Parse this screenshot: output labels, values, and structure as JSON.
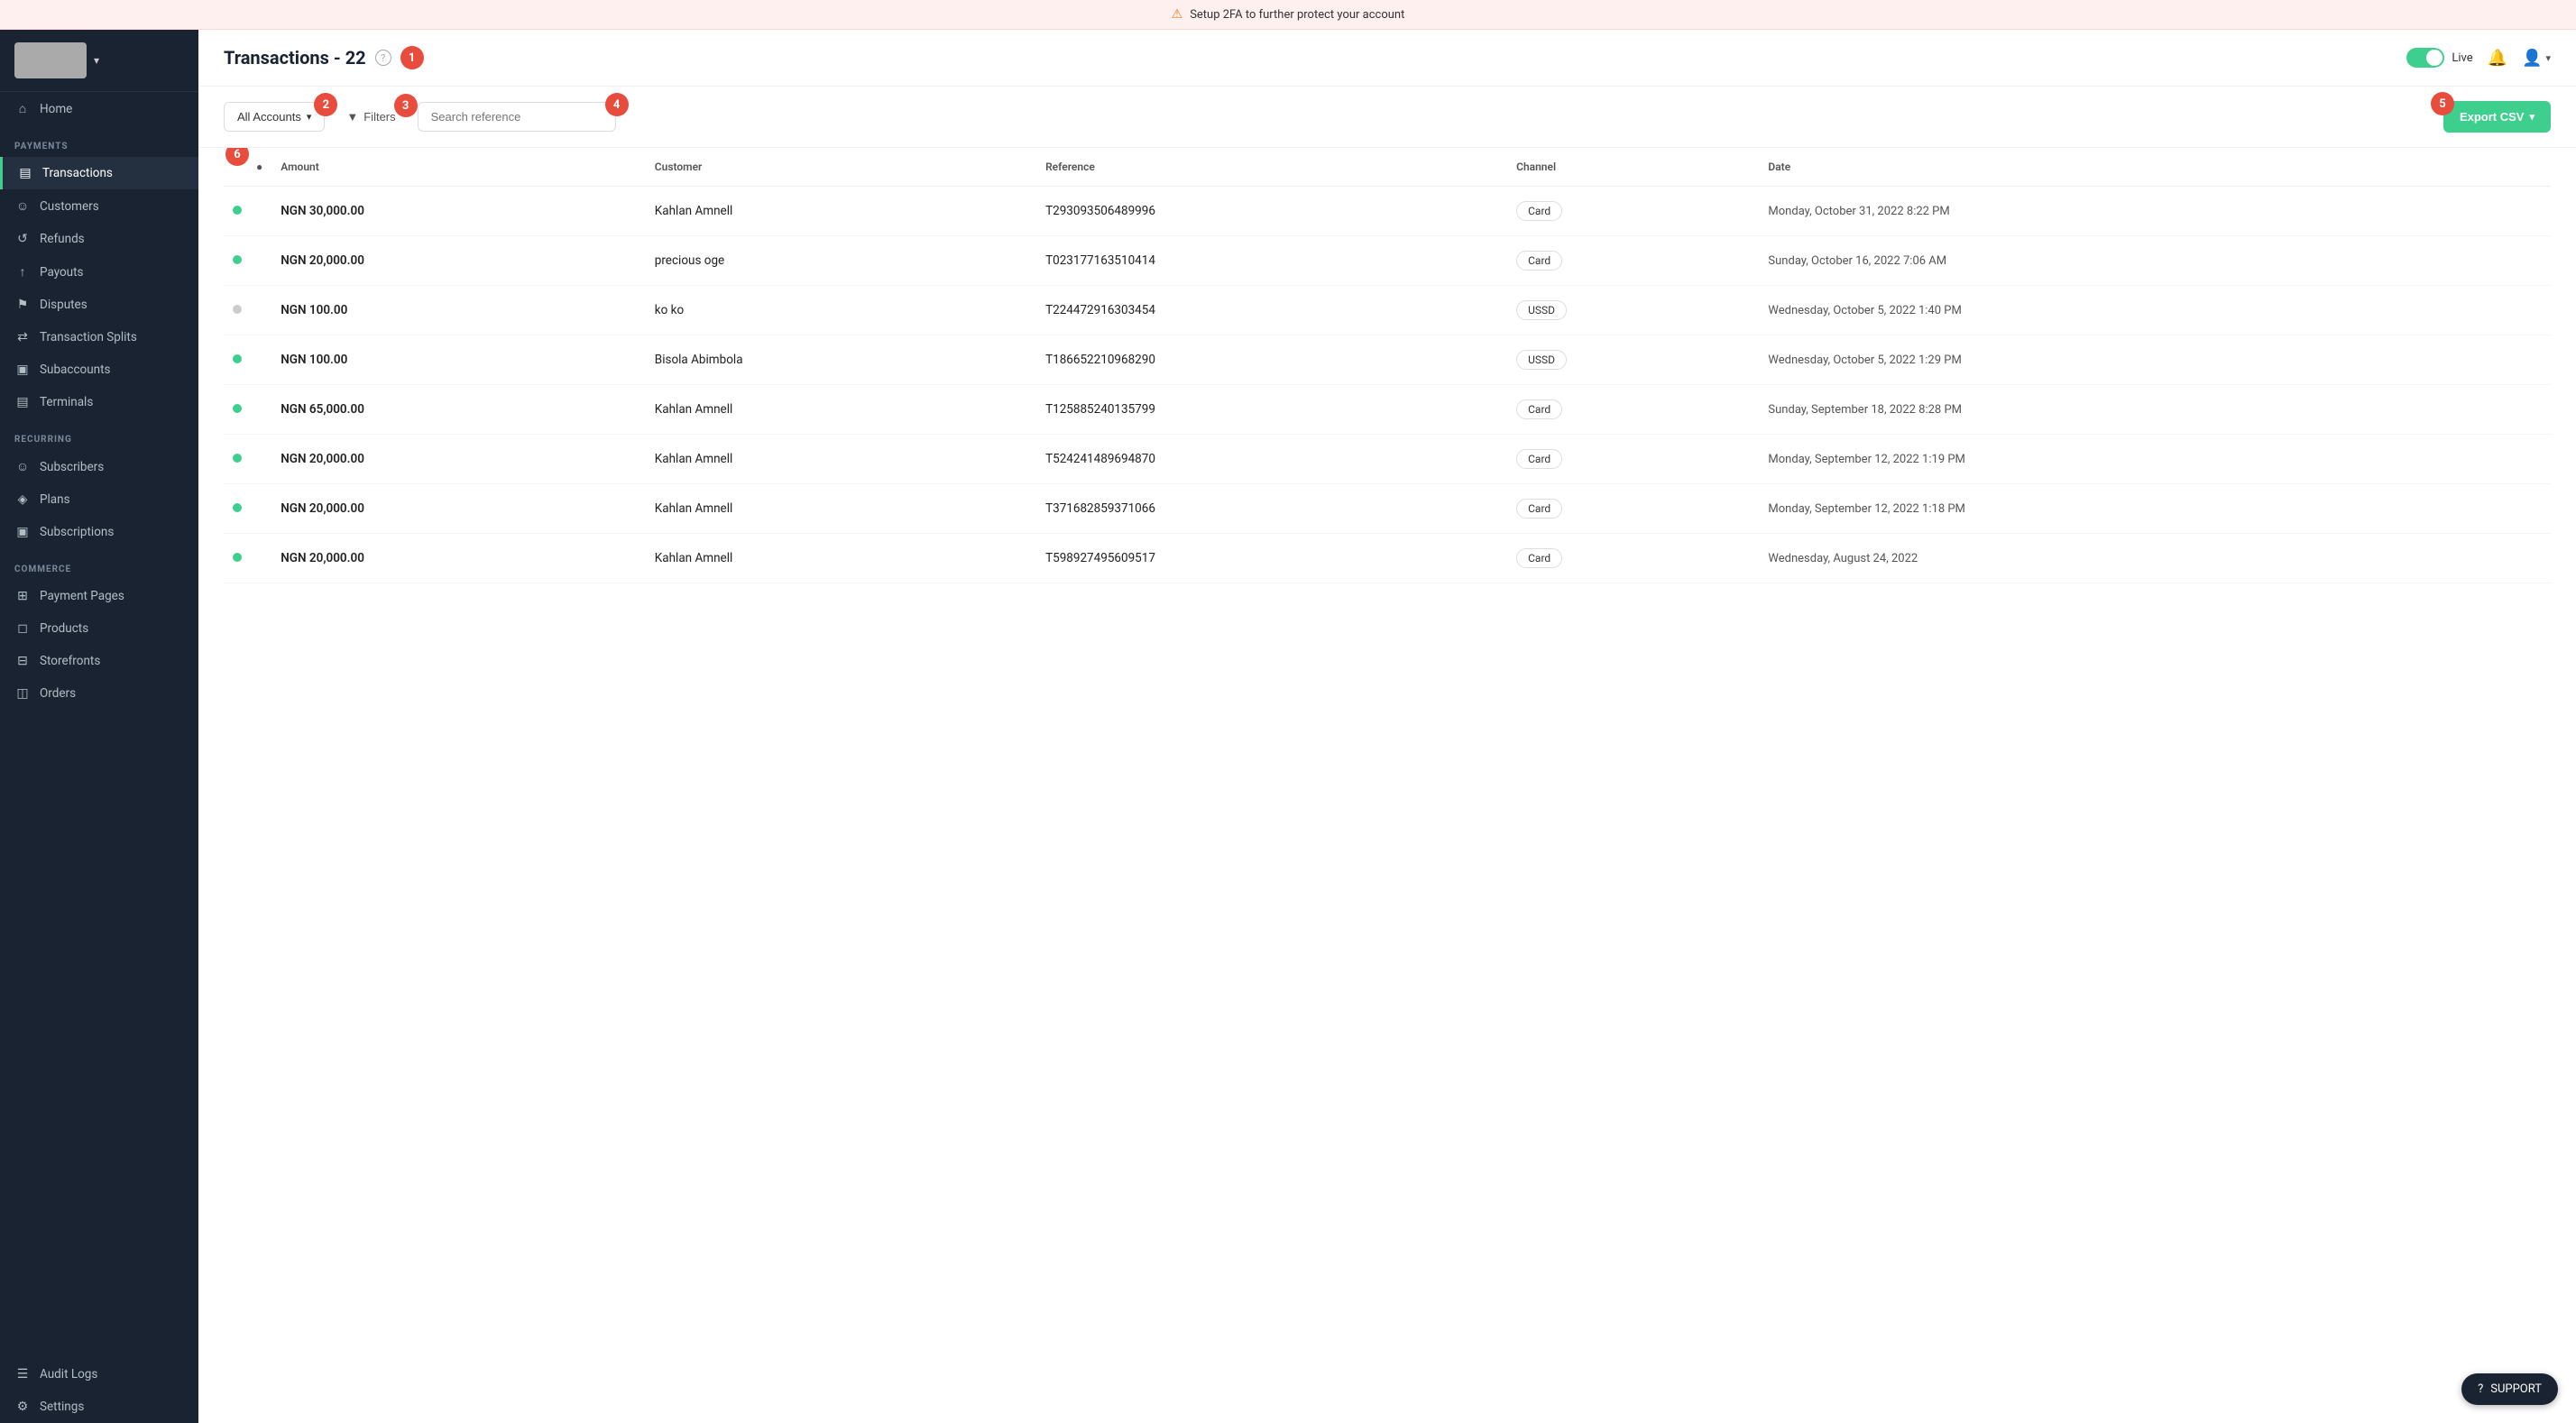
{
  "banner": {
    "text": "Setup 2FA to further protect your account"
  },
  "sidebar": {
    "sections": [
      {
        "label": "",
        "items": [
          {
            "id": "home",
            "icon": "⌂",
            "label": "Home",
            "active": false
          }
        ]
      },
      {
        "label": "PAYMENTS",
        "items": [
          {
            "id": "transactions",
            "icon": "▤",
            "label": "Transactions",
            "active": true
          },
          {
            "id": "customers",
            "icon": "☺",
            "label": "Customers",
            "active": false
          },
          {
            "id": "refunds",
            "icon": "↺",
            "label": "Refunds",
            "active": false
          },
          {
            "id": "payouts",
            "icon": "↑",
            "label": "Payouts",
            "active": false
          },
          {
            "id": "disputes",
            "icon": "⚑",
            "label": "Disputes",
            "active": false
          },
          {
            "id": "transaction-splits",
            "icon": "⇄",
            "label": "Transaction Splits",
            "active": false
          },
          {
            "id": "subaccounts",
            "icon": "▣",
            "label": "Subaccounts",
            "active": false
          },
          {
            "id": "terminals",
            "icon": "▤",
            "label": "Terminals",
            "active": false
          }
        ]
      },
      {
        "label": "RECURRING",
        "items": [
          {
            "id": "subscribers",
            "icon": "☺",
            "label": "Subscribers",
            "active": false
          },
          {
            "id": "plans",
            "icon": "◈",
            "label": "Plans",
            "active": false
          },
          {
            "id": "subscriptions",
            "icon": "▣",
            "label": "Subscriptions",
            "active": false
          }
        ]
      },
      {
        "label": "COMMERCE",
        "items": [
          {
            "id": "payment-pages",
            "icon": "⊞",
            "label": "Payment Pages",
            "active": false
          },
          {
            "id": "products",
            "icon": "◻",
            "label": "Products",
            "active": false
          },
          {
            "id": "storefronts",
            "icon": "⊟",
            "label": "Storefronts",
            "active": false
          },
          {
            "id": "orders",
            "icon": "◫",
            "label": "Orders",
            "active": false
          }
        ]
      },
      {
        "label": "",
        "items": [
          {
            "id": "audit-logs",
            "icon": "☰",
            "label": "Audit Logs",
            "active": false
          },
          {
            "id": "settings",
            "icon": "⚙",
            "label": "Settings",
            "active": false
          }
        ]
      }
    ]
  },
  "header": {
    "title": "Transactions",
    "count": "22",
    "callout_number": "1",
    "live_label": "Live",
    "export_label": "Export CSV"
  },
  "toolbar": {
    "accounts_label": "All Accounts",
    "filters_label": "Filters",
    "search_placeholder": "Search reference",
    "callout_accounts": "2",
    "callout_filters": "3",
    "callout_search": "4",
    "callout_export": "5"
  },
  "table": {
    "callout_select": "6",
    "columns": [
      "",
      "Amount",
      "Customer",
      "Reference",
      "Channel",
      "Date"
    ],
    "rows": [
      {
        "status": "green",
        "amount": "NGN 30,000.00",
        "customer": "Kahlan Amnell",
        "reference": "T293093506489996",
        "channel": "Card",
        "date": "Monday, October 31, 2022 8:22 PM"
      },
      {
        "status": "green",
        "amount": "NGN 20,000.00",
        "customer": "precious oge",
        "reference": "T023177163510414",
        "channel": "Card",
        "date": "Sunday, October 16, 2022 7:06 AM"
      },
      {
        "status": "gray",
        "amount": "NGN 100.00",
        "customer": "ko ko",
        "reference": "T224472916303454",
        "channel": "USSD",
        "date": "Wednesday, October 5, 2022 1:40 PM"
      },
      {
        "status": "green",
        "amount": "NGN 100.00",
        "customer": "Bisola Abimbola",
        "reference": "T186652210968290",
        "channel": "USSD",
        "date": "Wednesday, October 5, 2022 1:29 PM"
      },
      {
        "status": "green",
        "amount": "NGN 65,000.00",
        "customer": "Kahlan Amnell",
        "reference": "T125885240135799",
        "channel": "Card",
        "date": "Sunday, September 18, 2022 8:28 PM"
      },
      {
        "status": "green",
        "amount": "NGN 20,000.00",
        "customer": "Kahlan Amnell",
        "reference": "T524241489694870",
        "channel": "Card",
        "date": "Monday, September 12, 2022 1:19 PM"
      },
      {
        "status": "green",
        "amount": "NGN 20,000.00",
        "customer": "Kahlan Amnell",
        "reference": "T371682859371066",
        "channel": "Card",
        "date": "Monday, September 12, 2022 1:18 PM"
      },
      {
        "status": "green",
        "amount": "NGN 20,000.00",
        "customer": "Kahlan Amnell",
        "reference": "T598927495609517",
        "channel": "Card",
        "date": "Wednesday, August 24, 2022"
      }
    ]
  },
  "support": {
    "label": "SUPPORT"
  }
}
